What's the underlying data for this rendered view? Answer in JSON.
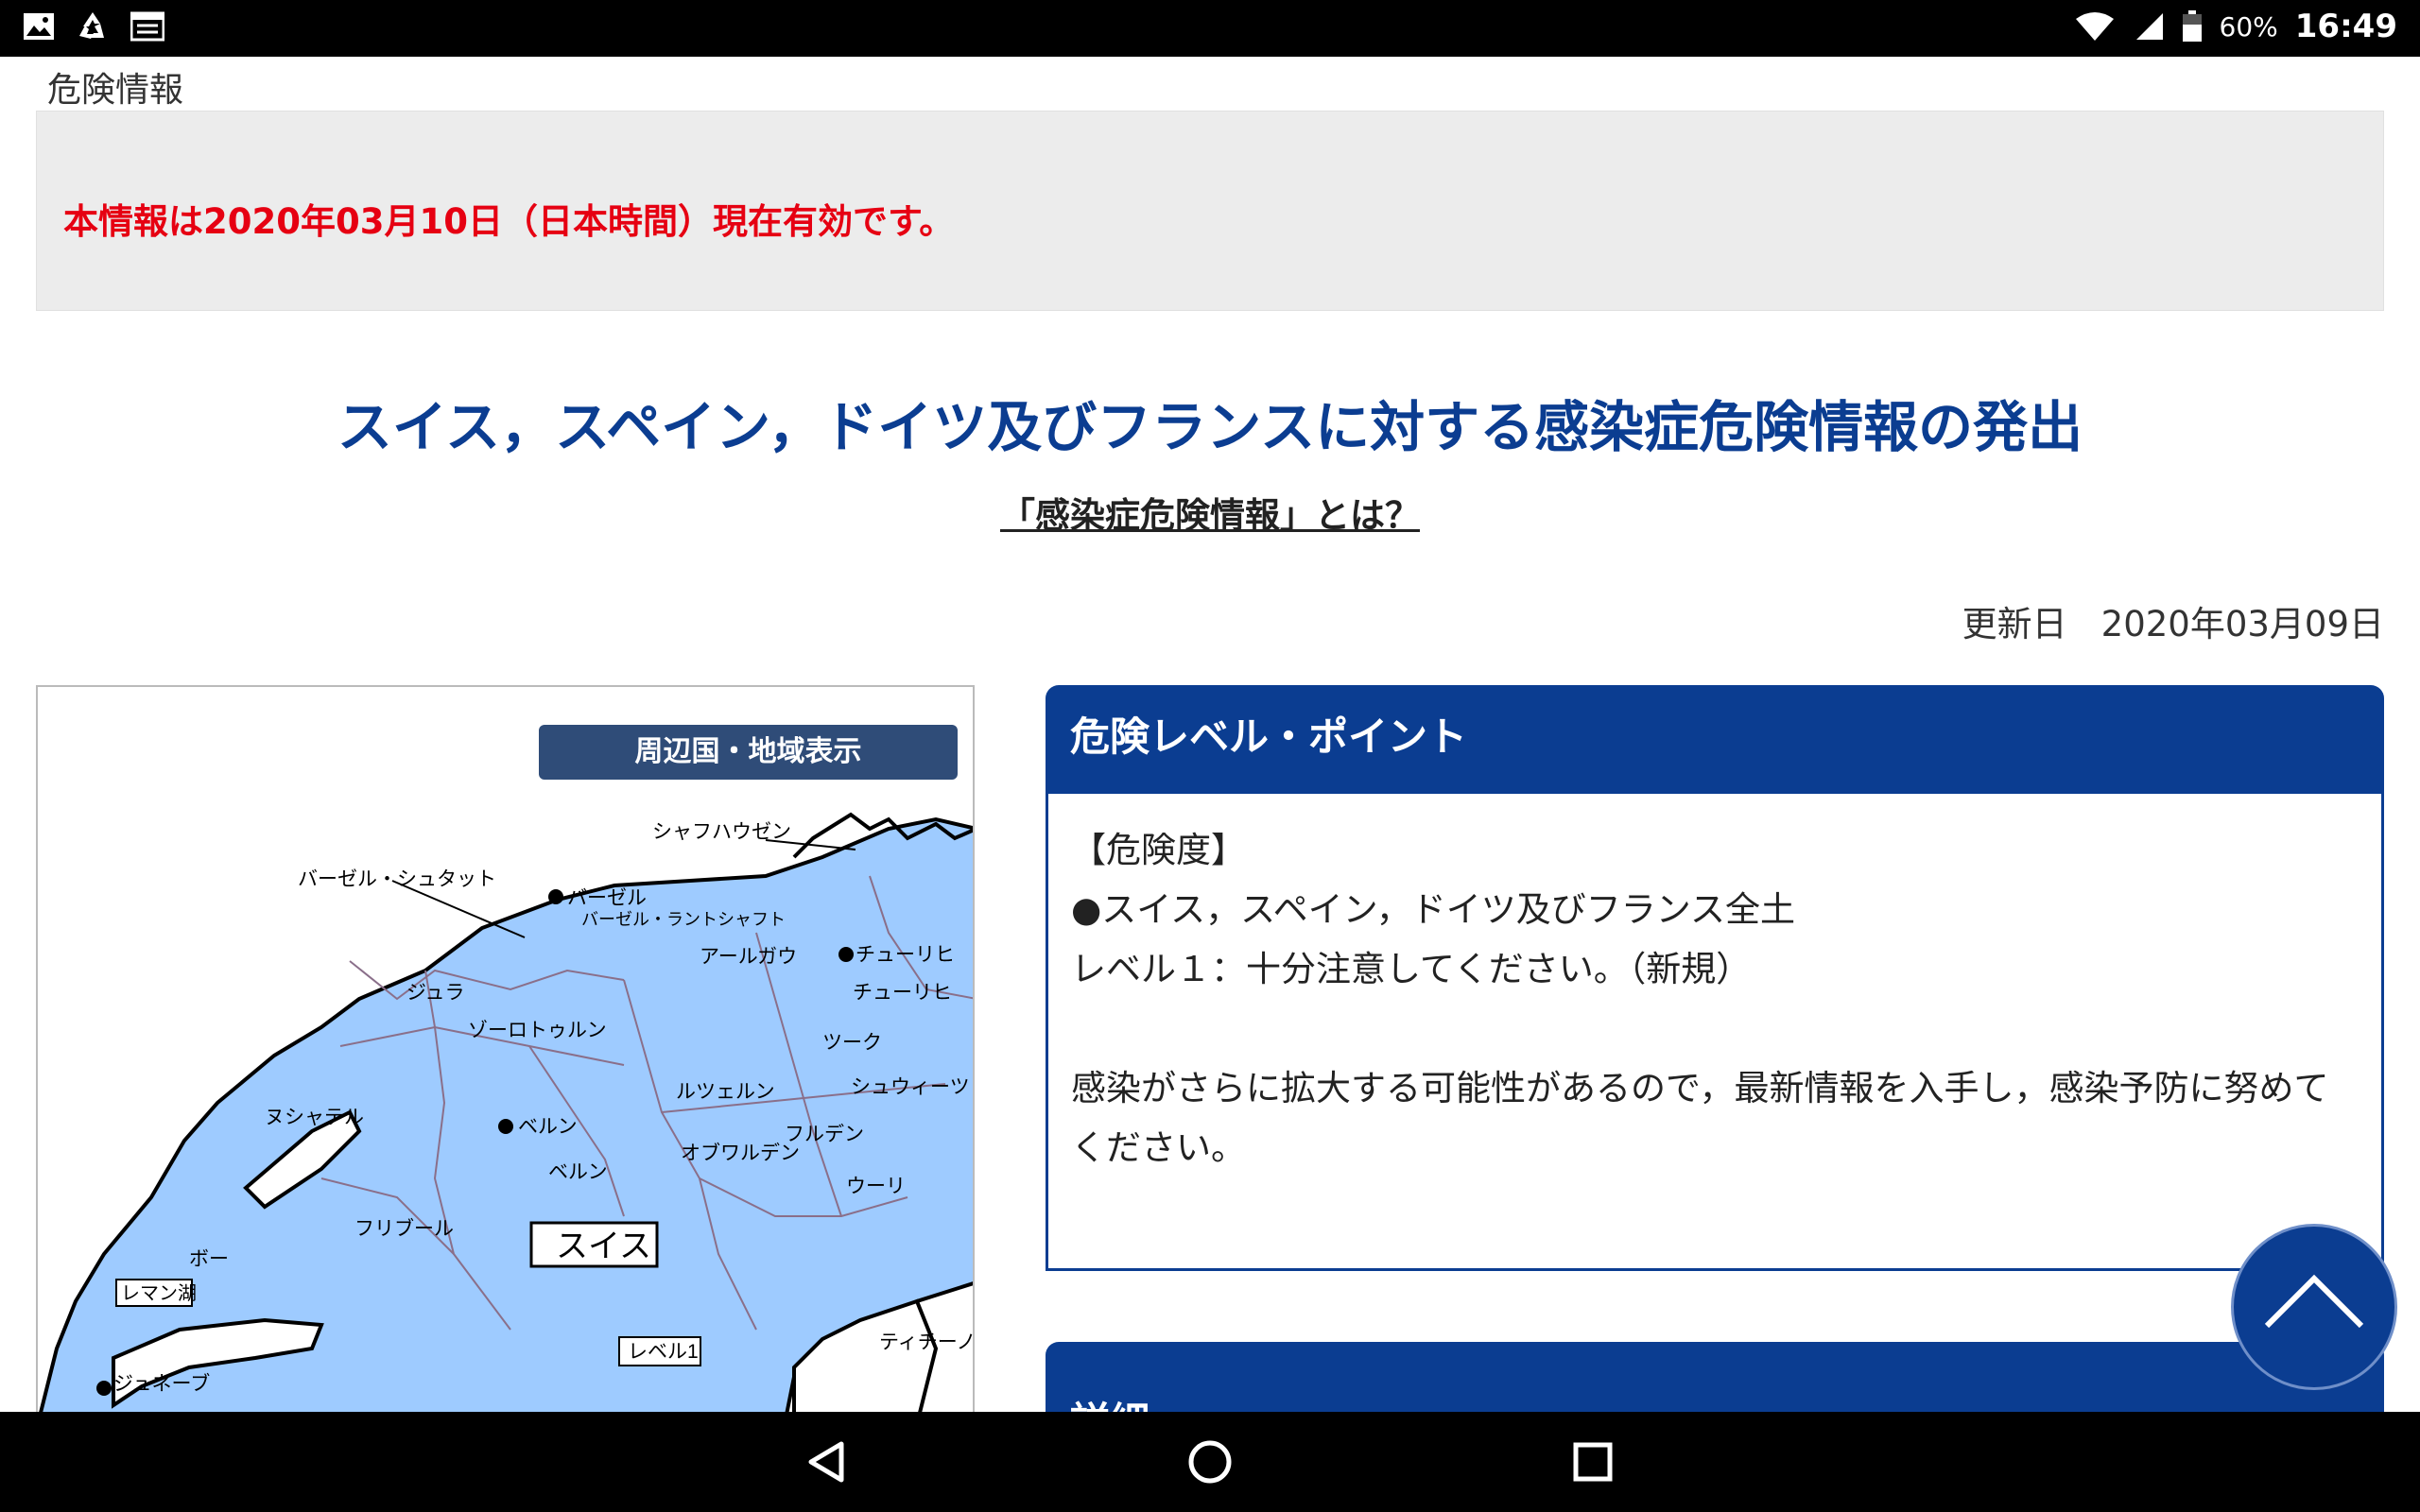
{
  "status_bar": {
    "battery": "60%",
    "time": "16:49",
    "left_icons": [
      "image-icon",
      "recycle-icon",
      "calendar-icon"
    ],
    "right_icons": [
      "wifi-icon",
      "signal-icon",
      "battery-icon"
    ]
  },
  "page": {
    "section_label": "危険情報",
    "notice": "本情報は2020年03月10日（日本時間）現在有効です。",
    "title": "スイス，スペイン，ドイツ及びフランスに対する感染症危険情報の発出",
    "about_link": "「感染症危険情報」とは？",
    "updated_label": "更新日",
    "updated_date": "2020年03月09日"
  },
  "map": {
    "button": "周辺国・地域表示",
    "country_label": "スイス",
    "level_label": "レベル1",
    "lake_label": "レマン湖",
    "places": [
      "シャフハウゼン",
      "バーゼル・シュタット",
      "バーゼル",
      "バーゼル・ラントシャフト",
      "アールガウ",
      "チューリヒ",
      "チューリヒ",
      "ジュラ",
      "ゾーロトゥルン",
      "ツーク",
      "ルツェルン",
      "シュウィーツ",
      "ヌシャテル",
      "ベルン",
      "ベルン",
      "オブワルデン",
      "フルデン",
      "ウーリ",
      "フリブール",
      "ボー",
      "ジュネーブ",
      "ティチーノ"
    ]
  },
  "level_panel": {
    "header": "危険レベル・ポイント",
    "line1": "【危険度】",
    "line2": "●スイス，スペイン，ドイツ及びフランス全土",
    "line3": "レベル１：十分注意してください。（新規）",
    "line4": "感染がさらに拡大する可能性があるので，最新情報を入手し，感染予防に努めてください。"
  },
  "detail_header": "詳細",
  "colors": {
    "primary": "#0b3d91",
    "alert": "#e60012",
    "map_fill": "#9ecbff",
    "map_button": "#2f4c78"
  }
}
